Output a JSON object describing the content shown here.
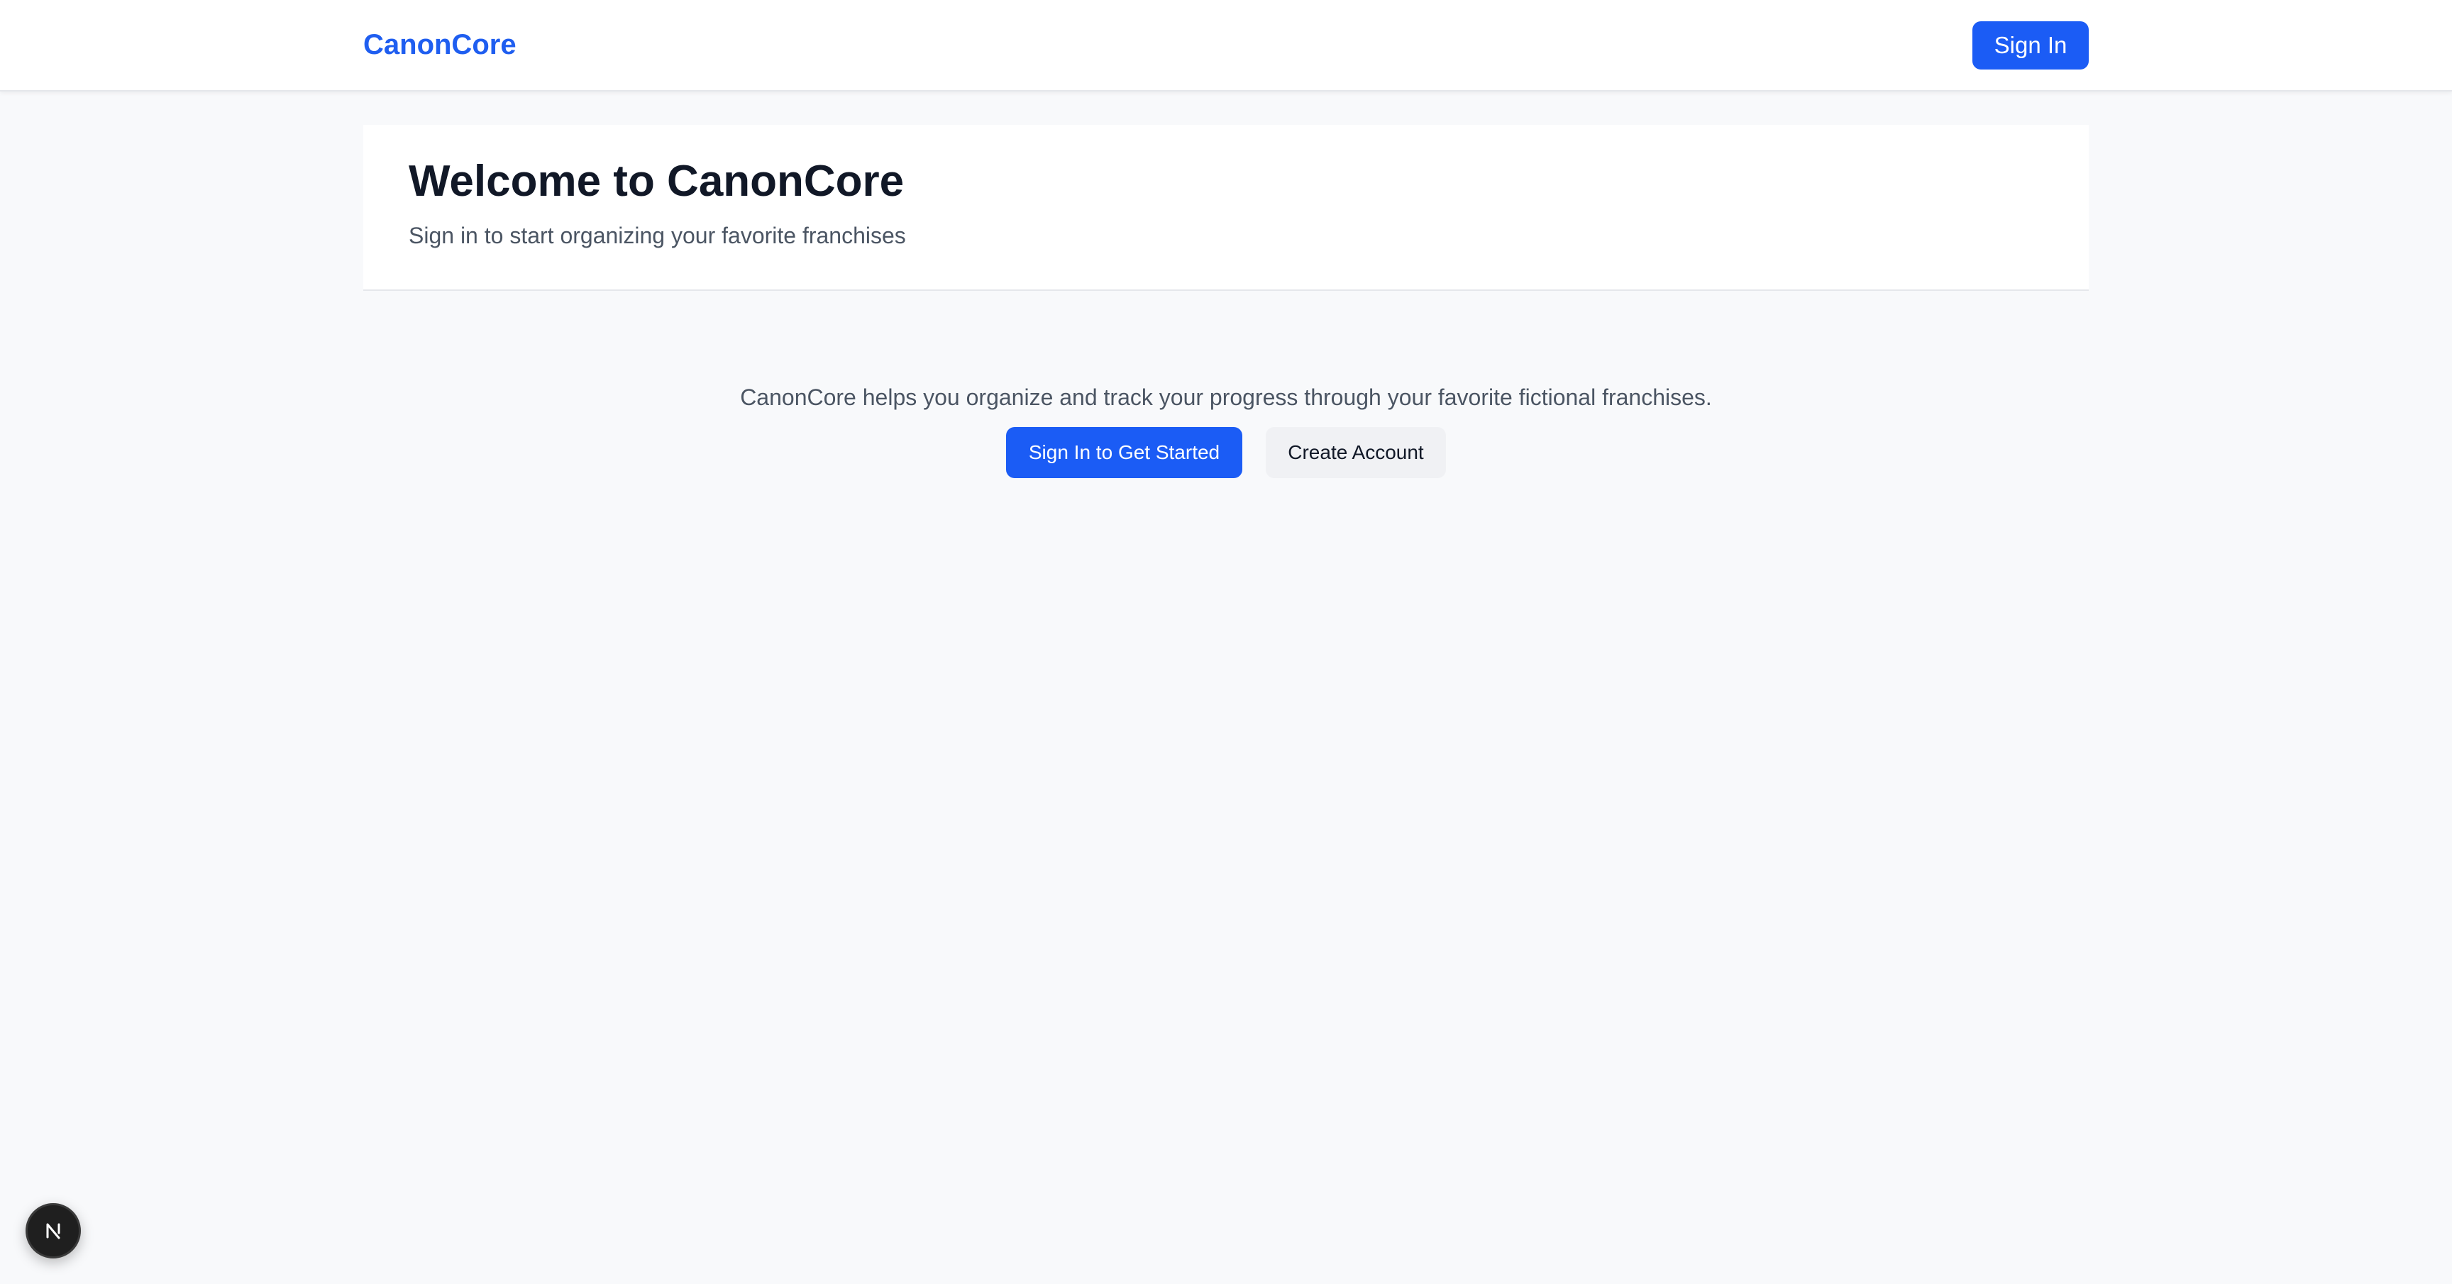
{
  "header": {
    "brand": "CanonCore",
    "sign_in_label": "Sign In"
  },
  "hero": {
    "title": "Welcome to CanonCore",
    "subtitle": "Sign in to start organizing your favorite franchises"
  },
  "main": {
    "description": "CanonCore helps you organize and track your progress through your favorite fictional franchises.",
    "primary_button_label": "Sign In to Get Started",
    "secondary_button_label": "Create Account"
  },
  "dev_badge": {
    "icon": "nextjs-logo-icon"
  },
  "colors": {
    "brand": "#1f5ef0",
    "primary_button": "#1b5cf5",
    "page_background": "#f8f9fb",
    "secondary_button": "#f0f1f4"
  }
}
